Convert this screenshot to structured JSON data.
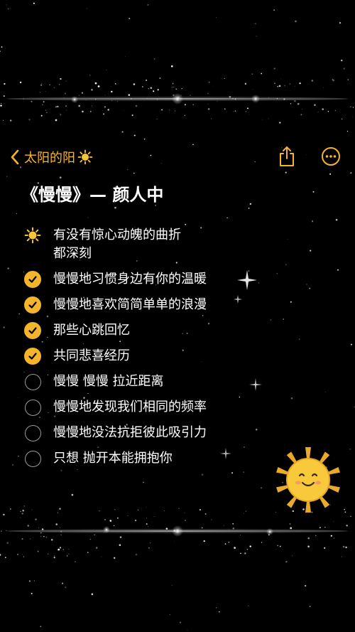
{
  "nav": {
    "back_label": "太阳的阳",
    "icons": [
      "chevron-left-icon",
      "sun-icon",
      "share-icon",
      "more-icon"
    ],
    "accent_color": "#f4b42b"
  },
  "note": {
    "title": "《慢慢》— 颜人中"
  },
  "checklist": [
    {
      "text": "有没有惊心动魄的曲折\n都深刻",
      "state": "sun"
    },
    {
      "text": "慢慢地习惯身边有你的温暖",
      "state": "checked"
    },
    {
      "text": "慢慢地喜欢简简单单的浪漫",
      "state": "checked"
    },
    {
      "text": "那些心跳回忆",
      "state": "checked"
    },
    {
      "text": "共同悲喜经历",
      "state": "checked"
    },
    {
      "text": "慢慢 慢慢 拉近距离",
      "state": "unchecked"
    },
    {
      "text": "慢慢地发现我们相同的频率",
      "state": "unchecked"
    },
    {
      "text": "慢慢地没法抗拒彼此吸引力",
      "state": "unchecked"
    },
    {
      "text": "只想 抛开本能拥抱你",
      "state": "unchecked"
    }
  ],
  "decoration": {
    "sticker": "smiling-sun-icon",
    "background": "starry-night"
  }
}
